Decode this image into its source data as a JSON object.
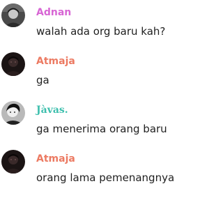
{
  "messages": [
    {
      "author": "Adnan",
      "author_color": "#d765d4",
      "text": "walah ada org baru kah?",
      "avatar": "user-photo-avatar"
    },
    {
      "author": "Atmaja",
      "author_color": "#ec7a62",
      "text": "ga",
      "avatar": "user-photo-avatar"
    },
    {
      "author": "Jàvas.",
      "author_color": "#3dbfad",
      "text": "ga menerima orang baru",
      "avatar": "user-photo-avatar"
    },
    {
      "author": "Atmaja",
      "author_color": "#ec7a62",
      "text": "orang lama pemenangnya",
      "avatar": "user-photo-avatar"
    }
  ]
}
